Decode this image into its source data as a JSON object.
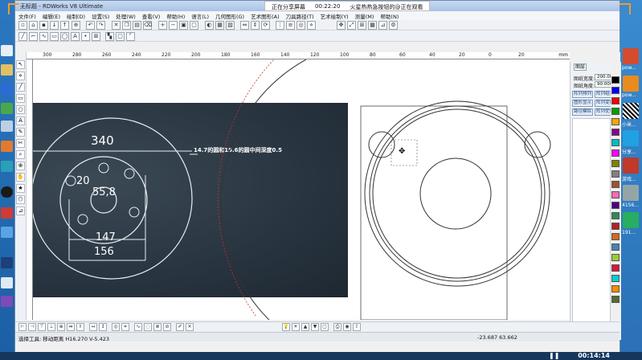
{
  "window": {
    "title": "无标题 - RDWorks V8 Ultimate"
  },
  "share_bar": {
    "status": "正在分享屏幕",
    "timer": "00:22:20",
    "notice": "火星热热急按钮的@正在观看"
  },
  "menu": [
    "文件(F)",
    "编辑(E)",
    "绘制(D)",
    "设置(S)",
    "处理(W)",
    "查看(V)",
    "帮助(H)",
    "语言(L)",
    "几何图形(G)",
    "艺术图形(A)",
    "刀具路径(T)",
    "艺术绘制(Y)",
    "测量(M)",
    "帮助(N)"
  ],
  "ruler": {
    "labels": [
      "300",
      "280",
      "260",
      "240",
      "220",
      "200",
      "180",
      "160",
      "140",
      "120",
      "100",
      "80",
      "60",
      "40",
      "20",
      "0",
      "20"
    ],
    "unit": "mm"
  },
  "photo": {
    "dim_outer": "340",
    "note": "14.7的圆和15.6的圆中间深度0.5",
    "dim_small": "20",
    "dim_center": "55,8",
    "dim_147": "147",
    "dim_156": "156"
  },
  "right_panel": {
    "tab": "图层",
    "row1_label": "图纸宽度:",
    "row1_value": "200.000",
    "row2_label": "图纸角度:",
    "row2_value": "90.000",
    "buttons": [
      "阵列排列",
      "阵列组合",
      "图形显示",
      "阵列变换",
      "路径模拟",
      "阵列优化"
    ],
    "palette": [
      "#000000",
      "#0000ff",
      "#ff0000",
      "#00a000",
      "#ffa500",
      "#8b008b",
      "#00bfbf",
      "#ff00ff",
      "#808000",
      "#808080",
      "#a0522d",
      "#ff69b4",
      "#4b0082",
      "#2e8b57",
      "#b22222",
      "#d2691e",
      "#4682b4",
      "#9acd32",
      "#dc143c",
      "#00ced1",
      "#ff8c00",
      "#556b2f"
    ]
  },
  "status": {
    "left": "选择工具: 移动距离 H16.270 V-5.423",
    "coords": "-23.687 63.662"
  },
  "taskbar": {
    "time": "00:14:14"
  },
  "desktop_right": {
    "labels": [
      "pow...",
      "pow...",
      "小米...",
      "分享...",
      "游戏...",
      "4156...",
      "191..."
    ]
  }
}
